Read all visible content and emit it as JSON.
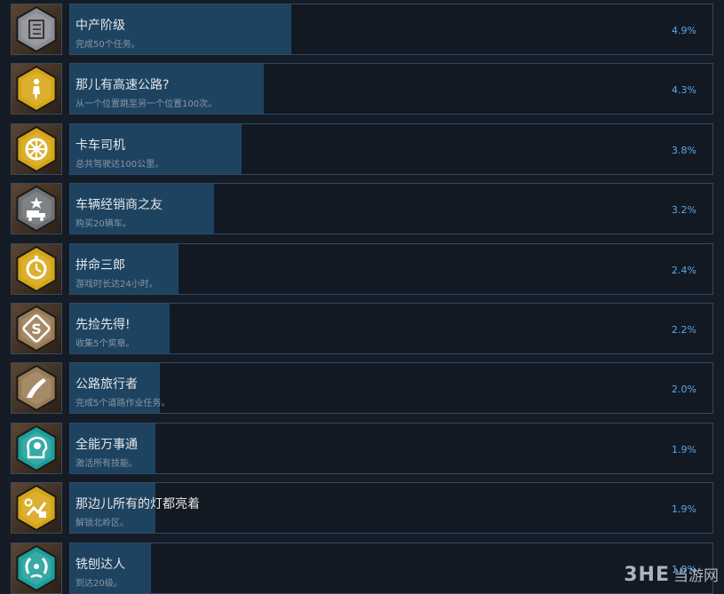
{
  "achievements": [
    {
      "title": "中产阶级",
      "description": "完成50个任务。",
      "percent_label": "4.9%",
      "percent": 4.9,
      "icon": "checklist-badge-icon",
      "badge_color": "#8a8d92"
    },
    {
      "title": "那儿有高速公路?",
      "description": "从一个位置跳至另一个位置100次。",
      "percent_label": "4.3%",
      "percent": 4.3,
      "icon": "person-badge-icon",
      "badge_color": "#d7a514"
    },
    {
      "title": "卡车司机",
      "description": "总共驾驶达100公里。",
      "percent_label": "3.8%",
      "percent": 3.8,
      "icon": "wheel-badge-icon",
      "badge_color": "#d7a514"
    },
    {
      "title": "车辆经销商之友",
      "description": "购买20辆车。",
      "percent_label": "3.2%",
      "percent": 3.2,
      "icon": "truck-star-badge-icon",
      "badge_color": "#6e7175"
    },
    {
      "title": "拼命三郎",
      "description": "游戏时长达24小时。",
      "percent_label": "2.4%",
      "percent": 2.4,
      "icon": "stopwatch-badge-icon",
      "badge_color": "#d7a514"
    },
    {
      "title": "先捡先得!",
      "description": "收集5个奖章。",
      "percent_label": "2.2%",
      "percent": 2.2,
      "icon": "medal-s-badge-icon",
      "badge_color": "#9a7b55"
    },
    {
      "title": "公路旅行者",
      "description": "完成5个道路作业任务。",
      "percent_label": "2.0%",
      "percent": 2.0,
      "icon": "road-badge-icon",
      "badge_color": "#9a7b55"
    },
    {
      "title": "全能万事通",
      "description": "激活所有技能。",
      "percent_label": "1.9%",
      "percent": 1.9,
      "icon": "skills-head-badge-icon",
      "badge_color": "#1d9f9a"
    },
    {
      "title": "那边儿所有的灯都亮着",
      "description": "解锁北岭区。",
      "percent_label": "1.9%",
      "percent": 1.9,
      "icon": "map-unlock-badge-icon",
      "badge_color": "#d7a514"
    },
    {
      "title": "铣刨达人",
      "description": "到达20级。",
      "percent_label": "1.8%",
      "percent": 1.8,
      "icon": "laurel-badge-icon",
      "badge_color": "#1d9f9a"
    }
  ],
  "watermark": {
    "logo": "3HE",
    "site": "当游网"
  }
}
